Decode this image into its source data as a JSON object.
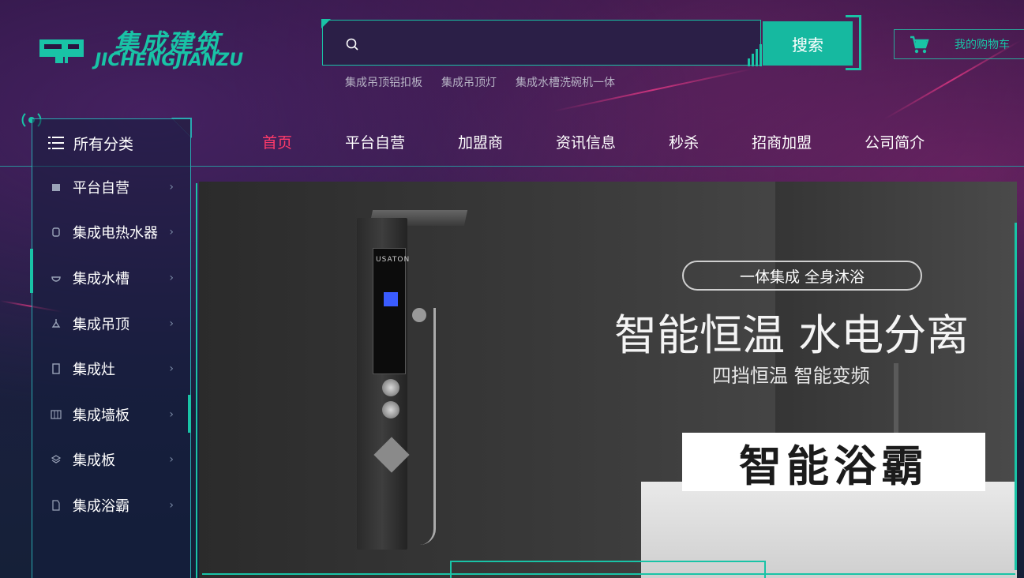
{
  "logo": {
    "cn": "集成建筑",
    "en": "JICHENGJIANZU"
  },
  "search": {
    "placeholder": "",
    "button_label": "搜索"
  },
  "hot_links": [
    "集成吊顶铝扣板",
    "集成吊顶灯",
    "集成水槽洗碗机一体"
  ],
  "cart": {
    "label": "我的购物车"
  },
  "nav": {
    "items": [
      {
        "label": "首页",
        "active": true
      },
      {
        "label": "平台自营"
      },
      {
        "label": "加盟商"
      },
      {
        "label": "资讯信息"
      },
      {
        "label": "秒杀"
      },
      {
        "label": "招商加盟"
      },
      {
        "label": "公司简介"
      }
    ]
  },
  "sidebar": {
    "title": "所有分类",
    "items": [
      {
        "label": "平台自营",
        "icon": "bag-icon"
      },
      {
        "label": "集成电热水器",
        "icon": "heater-icon"
      },
      {
        "label": "集成水槽",
        "icon": "sink-icon"
      },
      {
        "label": "集成吊顶",
        "icon": "lamp-icon"
      },
      {
        "label": "集成灶",
        "icon": "stove-icon"
      },
      {
        "label": "集成墙板",
        "icon": "wall-icon"
      },
      {
        "label": "集成板",
        "icon": "layers-icon"
      },
      {
        "label": "集成浴霸",
        "icon": "bath-icon"
      }
    ]
  },
  "banner": {
    "product_brand": "USATON",
    "tagline_pill": "一体集成 全身沐浴",
    "headline": "智能恒温 水电分离",
    "subline": "四挡恒温 智能变频",
    "promo": "智能浴霸"
  },
  "colors": {
    "accent": "#19c3a6",
    "active_nav": "#ff3b6a",
    "bg": "#2a1540"
  }
}
